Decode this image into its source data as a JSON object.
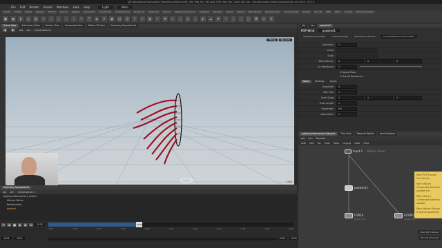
{
  "window": {
    "title": "[ATLAS/Work/vfx-dev/work_Files/VELLUM/VELLUM_FXR_998_Fan_VELLUM_FXR_998_Fan_Cloth_003.hip - Houdini Indie Limited-Commercial 19.5.534 - Py3.9"
  },
  "menu": [
    "File",
    "Edit",
    "Render",
    "Assets",
    "Windows",
    "Labs",
    "Help"
  ],
  "menu_extra": {
    "build": "Light",
    "desktop": "Main"
  },
  "shelf_tabs": [
    "Create",
    "Modify",
    "Model",
    "Polygon",
    "Deform",
    "Texture",
    "Rigging",
    "Characters",
    "Constraints",
    "Guide Process",
    "Terrain FX",
    "Simple FX",
    "Volume",
    "Lights and Cameras",
    "Collisions",
    "Particles",
    "Grains",
    "Vellum",
    "Rigid Bodies",
    "Particle Fluids",
    "Viscous Fluids",
    "Oceans",
    "Pyro FX",
    "FEM",
    "Wires",
    "Crowds",
    "Drive Simulation"
  ],
  "viewport": {
    "tabs": [
      "Scene View",
      "Animation Editor",
      "Render View",
      "Composite View",
      "Motion FX View",
      "Geometry Spreadsheet"
    ],
    "path": [
      "obj",
      "sim"
    ],
    "node_label": "vellumsolver1",
    "camera": "Persp",
    "no_cam": "No cam",
    "frame": "1200"
  },
  "param_pane": {
    "tabs": [
      "obj",
      "sim",
      "popwind1"
    ],
    "node_type": "POP Wind",
    "node_name": "popwind1",
    "sub_tabs": [
      "Asset Name and Path",
      "Channel Groups",
      "Performance Monitor"
    ],
    "path_field": "/usr/HOUDINI/houdini19.5/POP",
    "rows": [
      {
        "label": "Activation",
        "value": "1"
      },
      {
        "label": "Group",
        "value": ""
      },
      {
        "label": "Scale",
        "value": ""
      },
      {
        "label": "Wind Velocity",
        "value": "0",
        "extra": [
          "0",
          "0"
        ]
      },
      {
        "label": "Air Resistance",
        "value": "1"
      }
    ],
    "checks": [
      "Ignore Mass",
      "Use Air Resistance"
    ],
    "section_tabs": [
      "Noise",
      "Bindings",
      "Inputs"
    ],
    "noise_rows": [
      {
        "label": "Amplitude",
        "value": "0"
      },
      {
        "label": "Swirl Size",
        "value": "1"
      },
      {
        "label": "Grain Scale",
        "value": "1",
        "extra": [
          "1",
          "1"
        ]
      },
      {
        "label": "Pulse Length",
        "value": "1"
      },
      {
        "label": "Roughness",
        "value": "0.5"
      },
      {
        "label": "Attenuation",
        "value": "1"
      }
    ]
  },
  "network": {
    "tabs": [
      "/obj/sim/vellumsolver1/dopnet",
      "Tree View",
      "Material Palette",
      "Asset Browser"
    ],
    "path": [
      "obj",
      "sim",
      "Revisits"
    ],
    "menu": [
      "Add",
      "Edit",
      "Go",
      "View",
      "Tools",
      "Layout",
      "Labs",
      "Help"
    ],
    "input_label": "Input 1",
    "input_sub": "Vellum Solver",
    "nodes": [
      {
        "name": "popwind1",
        "sub": ""
      },
      {
        "name": "FORCE",
        "sub": "Output #0"
      },
      {
        "name": "SOURCE",
        "sub": "Output #1"
      }
    ],
    "note": [
      "Wire POP Forces into forces.",
      "Wire Vellum Constraint Blend to update con",
      "Wire Vellum Constraint Blend to update",
      "Wire Vellum Source S vellum geometry"
    ],
    "bottom_right": "Wire SOP Channel",
    "bottom_right2": "Mod All Channels"
  },
  "spreadsheet": {
    "tabs": [
      "Geometry Spreadsheet"
    ],
    "path": [
      "obj",
      "sim",
      "vellumsolver1"
    ],
    "tree": [
      "/obj/sim/vellumsolver1_dopnet",
      "Affector Matrix",
      "Relationships",
      "external"
    ],
    "tree_tabs": [
      "obj",
      "sim",
      "vellumsolver1",
      "Revisits"
    ]
  },
  "timeline": {
    "frame": "1033",
    "start": "1001",
    "start2": "1001",
    "end": "1200",
    "end2": "1200",
    "ticks": [
      "1001",
      "1020",
      "1040",
      "1060",
      "1080",
      "1100",
      "1120",
      "1140",
      "1160",
      "1180",
      "1200"
    ],
    "marker": "1033",
    "progress": 0.37
  }
}
